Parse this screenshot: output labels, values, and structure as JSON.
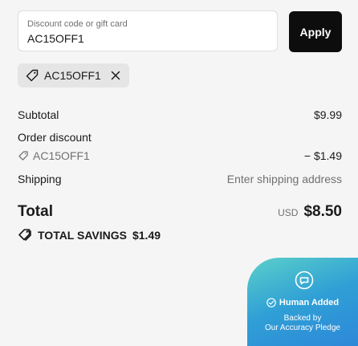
{
  "discount": {
    "label": "Discount code or gift card",
    "value": "AC15OFF1",
    "apply_label": "Apply"
  },
  "applied_code": {
    "code": "AC15OFF1",
    "remove_icon": "close-icon",
    "icon": "tag-icon"
  },
  "summary": {
    "subtotal_label": "Subtotal",
    "subtotal_value": "$9.99",
    "order_discount_label": "Order discount",
    "order_discount_code": "AC15OFF1",
    "order_discount_value": "− $1.49",
    "shipping_label": "Shipping",
    "shipping_value": "Enter shipping address",
    "total_label": "Total",
    "currency": "USD",
    "total_value": "$8.50",
    "savings_label": "TOTAL SAVINGS",
    "savings_value": "$1.49"
  },
  "badge": {
    "title": "Human Added",
    "line1": "Backed by",
    "line2": "Our Accuracy Pledge",
    "icon": "chat-bubble-icon",
    "check_icon": "check-circle-icon",
    "gradient_start": "#5bd0c9",
    "gradient_end": "#2e88d8"
  },
  "colors": {
    "button_bg": "#0d0d0d",
    "chip_bg": "#e5e5e5",
    "muted_text": "#707070",
    "page_bg": "#f5f5f5"
  }
}
